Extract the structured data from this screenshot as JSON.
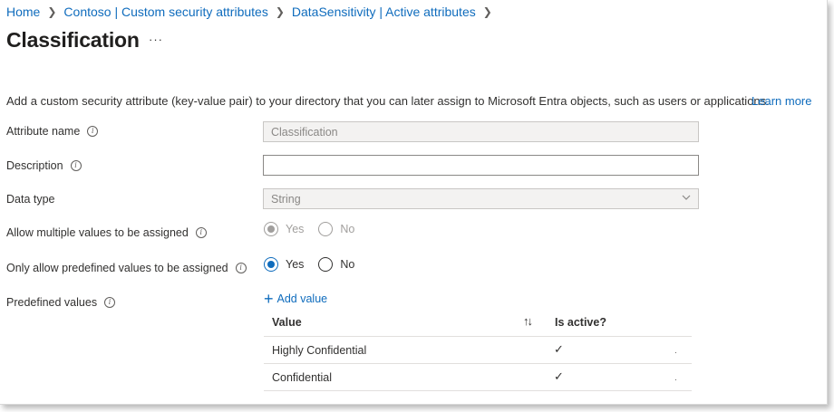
{
  "breadcrumb": [
    {
      "label": "Home"
    },
    {
      "label": "Contoso | Custom security attributes"
    },
    {
      "label": "DataSensitivity | Active attributes"
    }
  ],
  "page": {
    "title": "Classification",
    "more_label": "···"
  },
  "intro": {
    "text": "Add a custom security attribute (key-value pair) to your directory that you can later assign to Microsoft Entra objects, such as users or applications.",
    "learn_more": "Learn more"
  },
  "form": {
    "attribute_name": {
      "label": "Attribute name",
      "value": "Classification"
    },
    "description": {
      "label": "Description",
      "value": ""
    },
    "data_type": {
      "label": "Data type",
      "value": "String"
    },
    "allow_multiple": {
      "label": "Allow multiple values to be assigned",
      "yes": "Yes",
      "no": "No",
      "selected": "Yes",
      "disabled": true
    },
    "only_predefined": {
      "label": "Only allow predefined values to be assigned",
      "yes": "Yes",
      "no": "No",
      "selected": "Yes",
      "disabled": false
    },
    "predefined_values": {
      "label": "Predefined values",
      "add_label": "Add value"
    }
  },
  "table": {
    "columns": {
      "value": "Value",
      "is_active": "Is active?"
    },
    "rows": [
      {
        "value": "Highly Confidential",
        "is_active": "✓",
        "dot": "."
      },
      {
        "value": "Confidential",
        "is_active": "✓",
        "dot": "."
      }
    ]
  },
  "colors": {
    "accent": "#0f6cbd",
    "text": "#323130",
    "disabled_bg": "#f3f2f1"
  }
}
